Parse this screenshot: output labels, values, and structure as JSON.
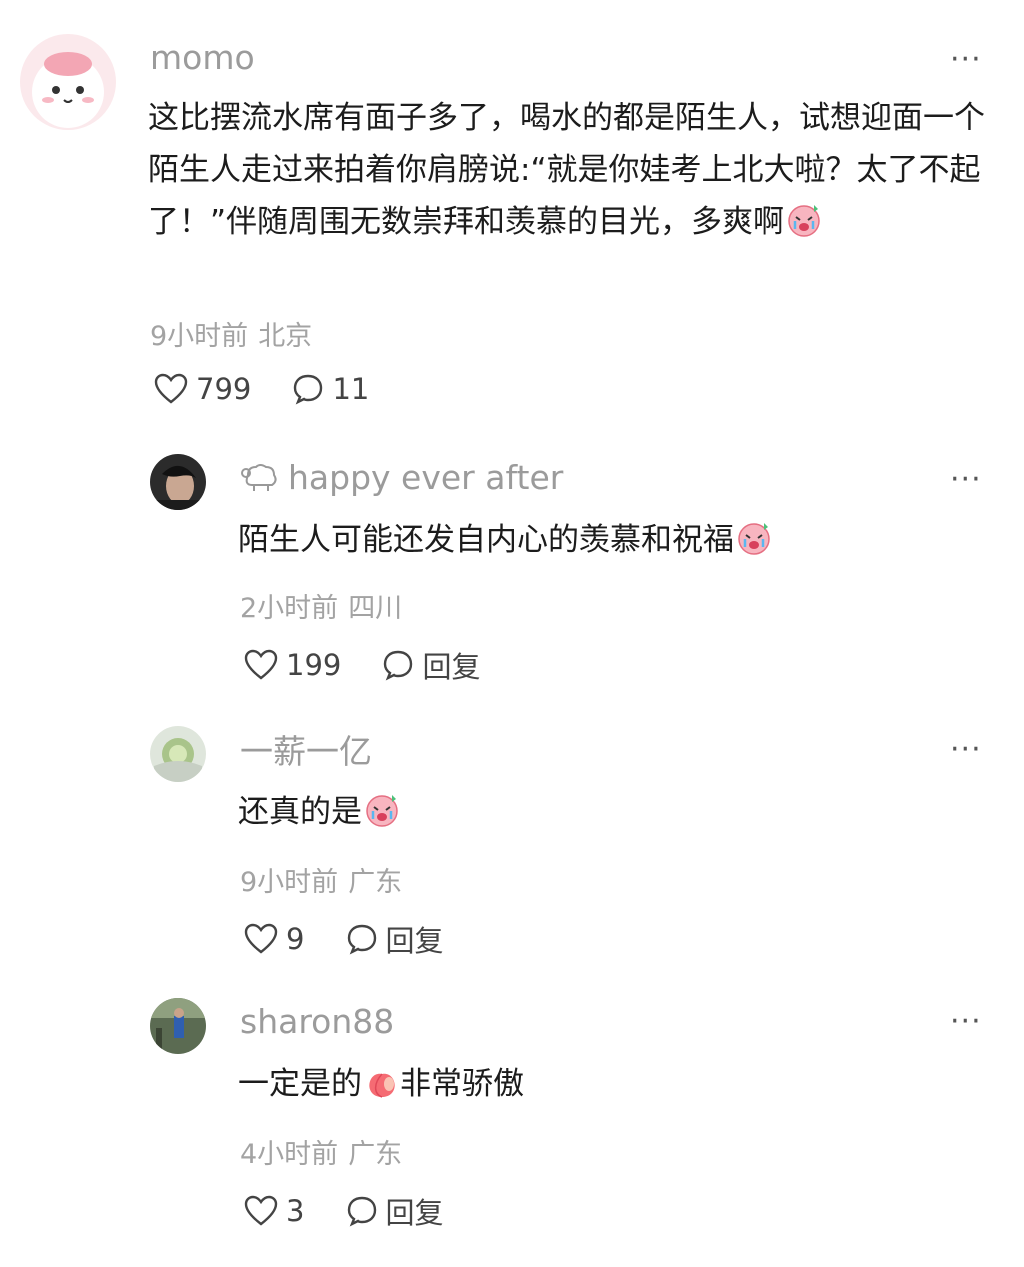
{
  "comments": [
    {
      "author": "momo",
      "text": "这比摆流水席有面子多了，喝水的都是陌生人，试想迎面一个陌生人走过来拍着你肩膀说:“就是你娃考上北大啦？太了不起了！”伴随周围无数崇拜和羡慕的目光，多爽啊",
      "time": "9小时前",
      "location": "北京",
      "likes": "799",
      "replies": "11",
      "avatar_color": "#f6d3d8"
    },
    {
      "author": "happy ever after",
      "text": "陌生人可能还发自内心的羡慕和祝福",
      "time": "2小时前",
      "location": "四川",
      "likes": "199",
      "reply_label": "回复"
    },
    {
      "author": "一薪一亿",
      "text": "还真的是",
      "time": "9小时前",
      "location": "广东",
      "likes": "9",
      "reply_label": "回复"
    },
    {
      "author": "sharon88",
      "text_before": "一定是的",
      "text_after": "非常骄傲",
      "time": "4小时前",
      "location": "广东",
      "likes": "3",
      "reply_label": "回复"
    }
  ],
  "more_label": "···",
  "icons": {
    "like": "heart-outline-icon",
    "comment": "speech-bubble-icon",
    "more": "more-dots-icon",
    "emoji_cry": "crying-face-emoji",
    "emoji_peach": "peach-emoji",
    "member_badge": "sheep-badge-icon"
  }
}
